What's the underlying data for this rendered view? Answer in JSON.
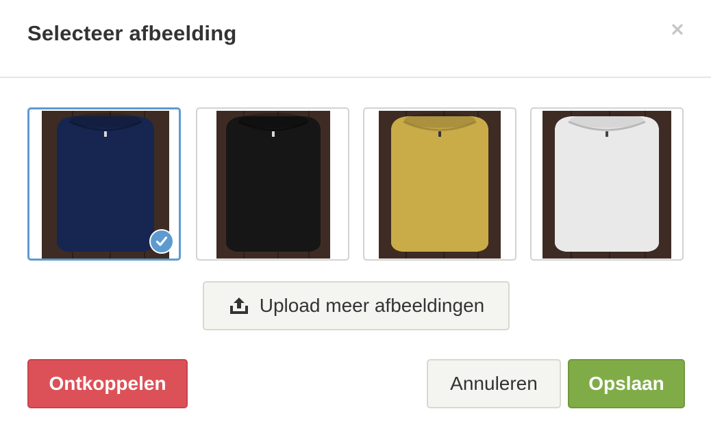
{
  "dialog": {
    "title": "Selecteer afbeelding",
    "close_icon": "close-icon"
  },
  "images": [
    {
      "name": "navy-tshirt",
      "shirt_color": "#162650",
      "selected": true
    },
    {
      "name": "black-tshirt",
      "shirt_color": "#161616",
      "selected": false
    },
    {
      "name": "yellow-tshirt",
      "shirt_color": "#c9ab48",
      "selected": false
    },
    {
      "name": "white-tshirt",
      "shirt_color": "#e9e9e9",
      "selected": false
    }
  ],
  "upload": {
    "label": "Upload meer afbeeldingen",
    "icon": "upload-icon"
  },
  "footer": {
    "unlink_label": "Ontkoppelen",
    "cancel_label": "Annuleren",
    "save_label": "Opslaan"
  },
  "colors": {
    "selected_border": "#5d9ad0",
    "danger": "#dc5157",
    "success": "#80ac48",
    "wood_background": "#3e2c24"
  }
}
